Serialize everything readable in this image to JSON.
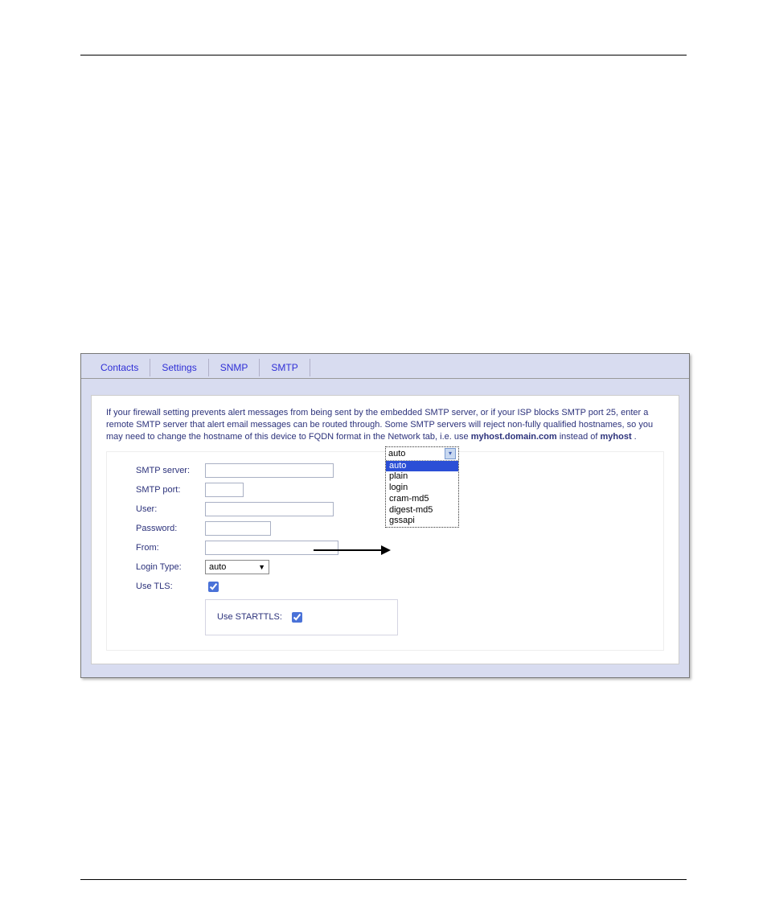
{
  "tabs": {
    "contacts": "Contacts",
    "settings": "Settings",
    "snmp": "SNMP",
    "smtp": "SMTP"
  },
  "info": {
    "line1_a": "If your firewall setting prevents alert messages from being sent by the embedded SMTP server, or if your ISP blocks SMTP port 25, enter a remote SMTP server that alert email messages can be routed through. Some SMTP servers will reject non-fully qualified hostnames, so you may need to change the hostname of this device to FQDN format in the Network tab, i.e. use ",
    "bold1": "myhost.domain.com",
    "line1_b": " instead of ",
    "bold2": "myhost",
    "line1_c": " ."
  },
  "form": {
    "smtp_server_label": "SMTP server:",
    "smtp_server_value": "",
    "smtp_port_label": "SMTP port:",
    "smtp_port_value": "",
    "user_label": "User:",
    "user_value": "",
    "password_label": "Password:",
    "password_value": "",
    "from_label": "From:",
    "from_value": "",
    "login_type_label": "Login Type:",
    "login_type_value": "auto",
    "use_tls_label": "Use TLS:",
    "use_starttls_label": "Use STARTTLS:"
  },
  "dropdown": {
    "selected_display": "auto",
    "options": {
      "o0": "auto",
      "o1": "plain",
      "o2": "login",
      "o3": "cram-md5",
      "o4": "digest-md5",
      "o5": "gssapi"
    }
  }
}
